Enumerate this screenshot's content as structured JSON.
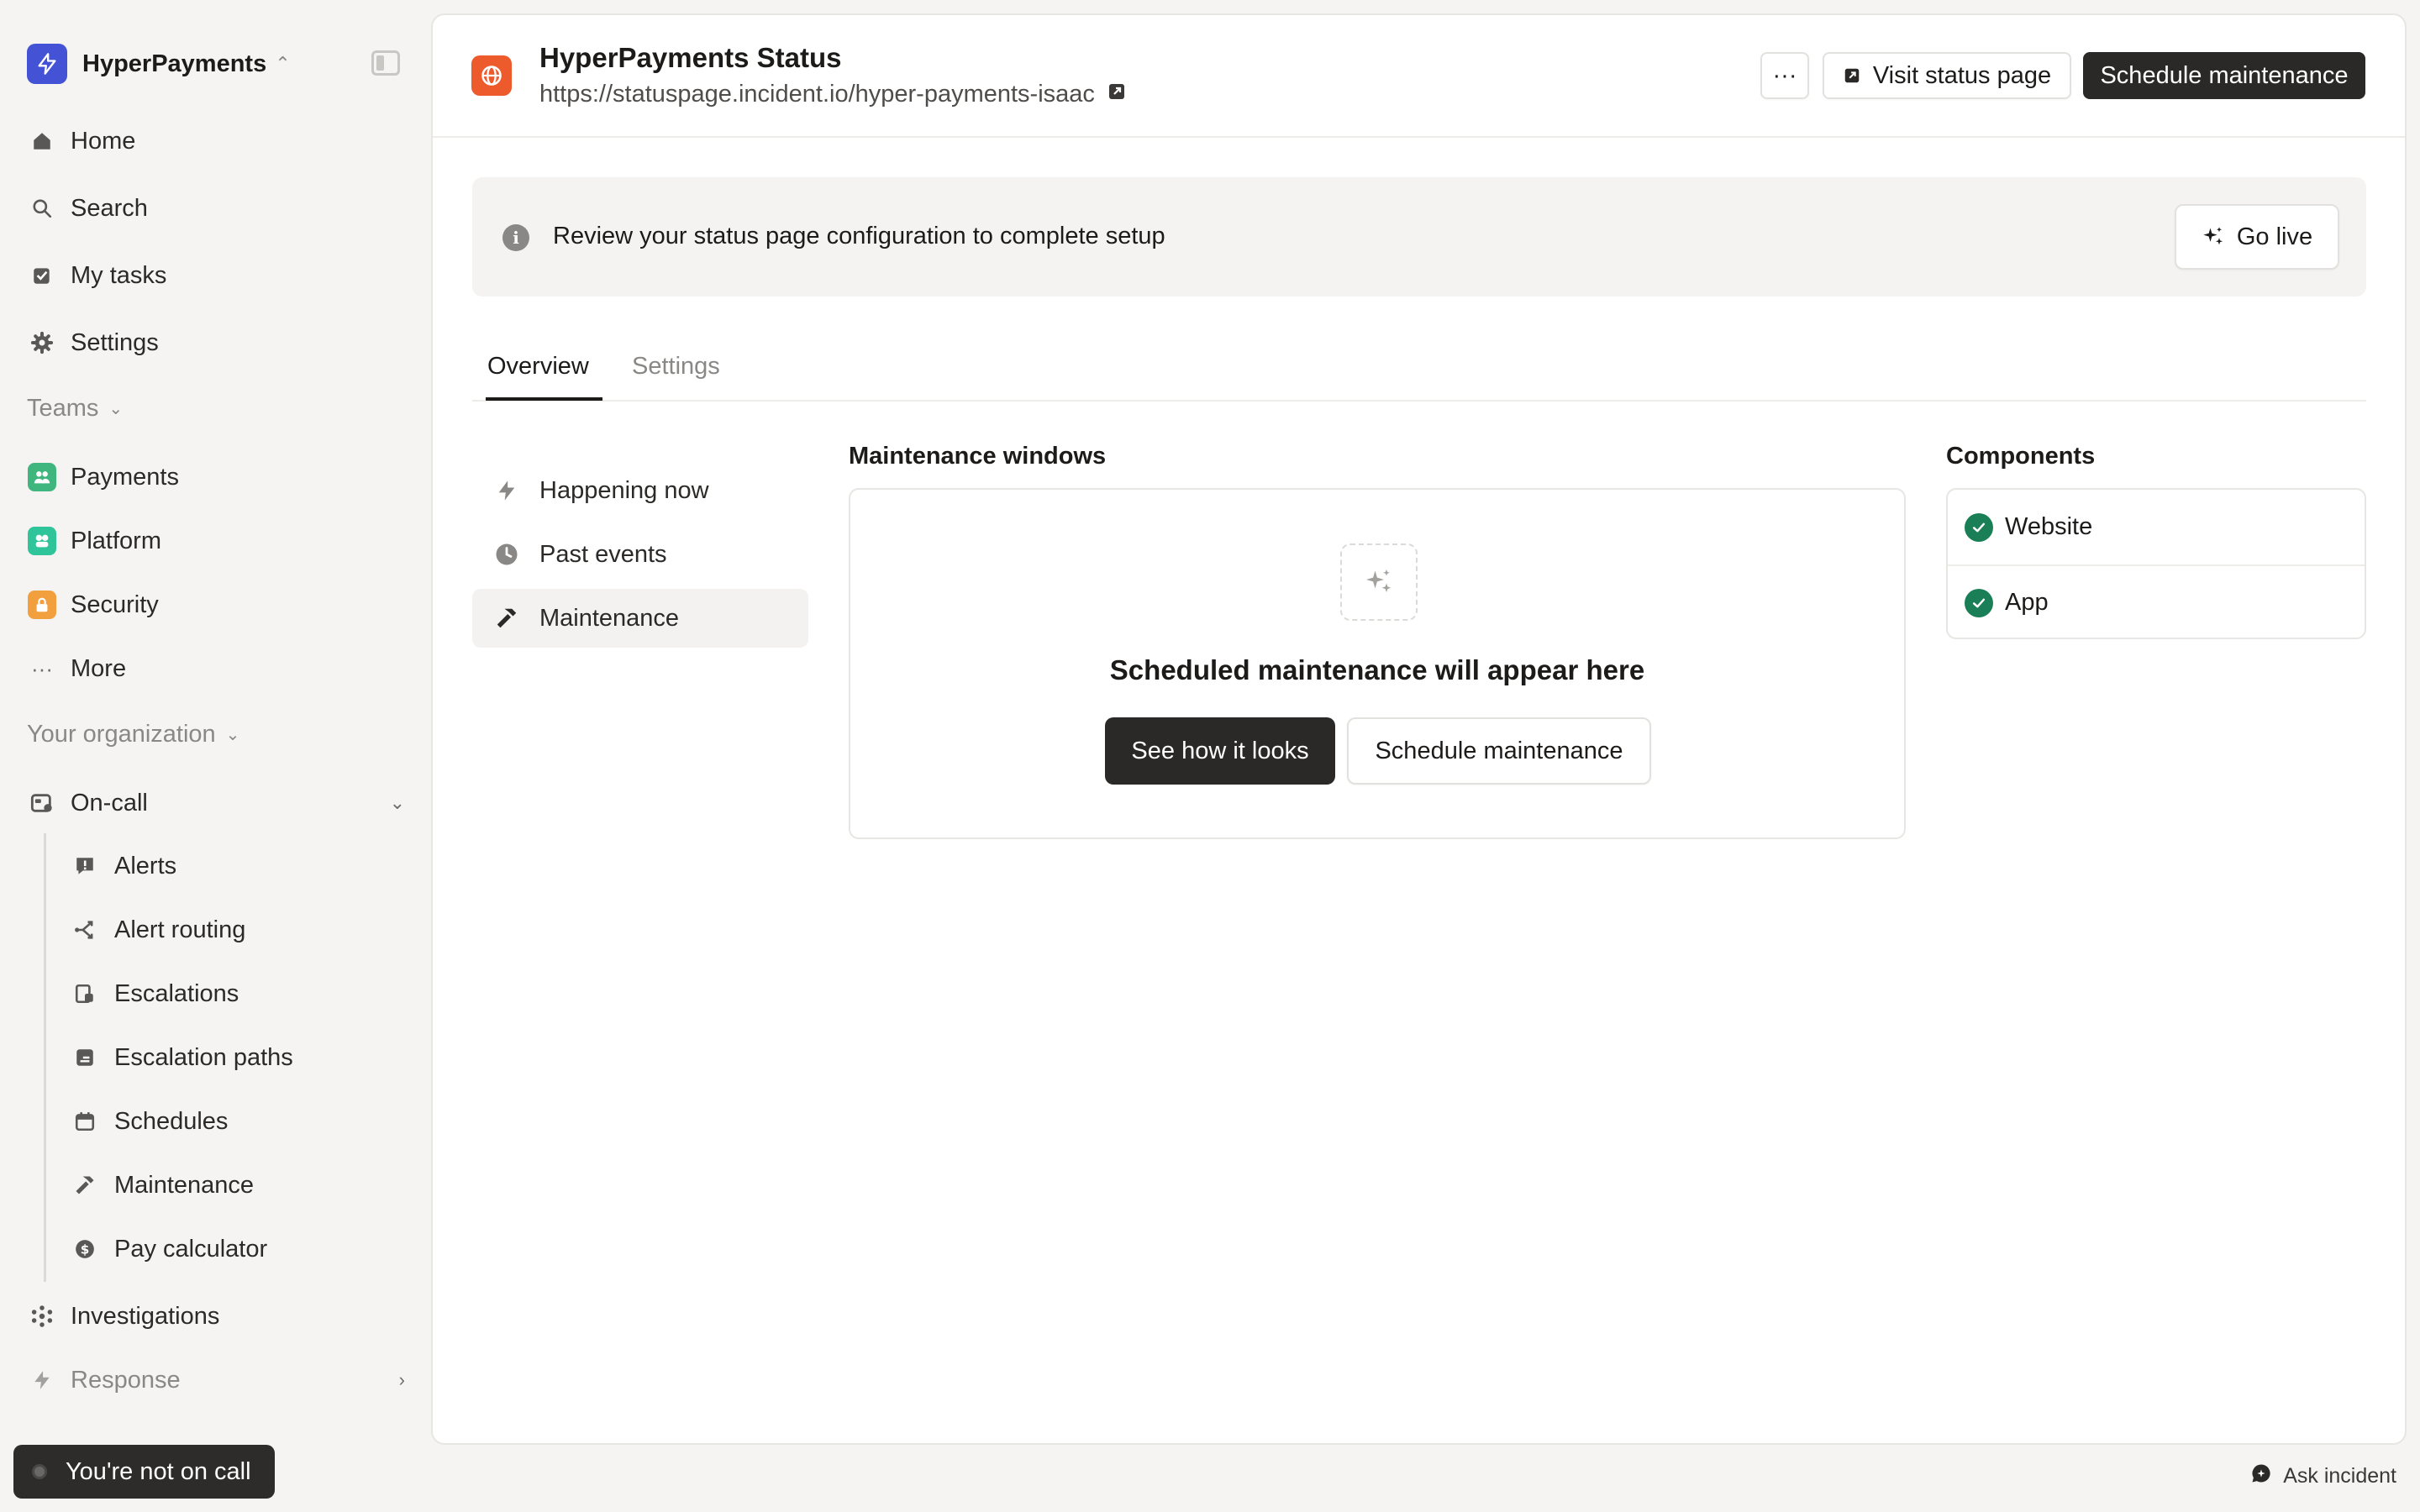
{
  "org": {
    "name": "HyperPayments"
  },
  "nav": {
    "home": "Home",
    "search": "Search",
    "my_tasks": "My tasks",
    "settings": "Settings",
    "teams_label": "Teams",
    "teams": [
      {
        "label": "Payments",
        "color": "#3fb67e"
      },
      {
        "label": "Platform",
        "color": "#2fc49a"
      },
      {
        "label": "Security",
        "color": "#f29f3d"
      }
    ],
    "more": "More",
    "org_label": "Your organization",
    "oncall": "On-call",
    "oncall_items": [
      "Alerts",
      "Alert routing",
      "Escalations",
      "Escalation paths",
      "Schedules",
      "Maintenance",
      "Pay calculator"
    ],
    "investigations": "Investigations",
    "response": "Response"
  },
  "oncall_status": "You're not on call",
  "ask_incident": "Ask incident",
  "page": {
    "title": "HyperPayments Status",
    "url": "https://statuspage.incident.io/hyper-payments-isaac",
    "more_label": "···",
    "visit_label": "Visit status page",
    "schedule_label": "Schedule maintenance"
  },
  "banner": {
    "text": "Review your status page configuration to complete setup",
    "go_live": "Go live"
  },
  "tabs": [
    "Overview",
    "Settings"
  ],
  "subnav": [
    "Happening now",
    "Past events",
    "Maintenance"
  ],
  "maintenance": {
    "title": "Maintenance windows",
    "empty_title": "Scheduled maintenance will appear here",
    "see_how": "See how it looks",
    "schedule": "Schedule maintenance"
  },
  "components": {
    "title": "Components",
    "items": [
      "Website",
      "App"
    ]
  },
  "colors": {
    "accent_dark": "#2a2927",
    "status_ok": "#1a7f56",
    "org_logo": "#4452d6",
    "status_page_logo": "#ed5a2b"
  }
}
